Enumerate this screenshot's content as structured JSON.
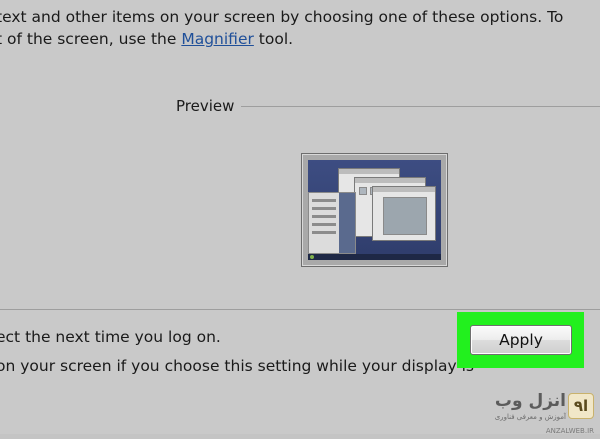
{
  "intro": {
    "line1": "text and other items on your screen by choosing one of these options. To",
    "line2_before_link": "t of the screen, use the ",
    "line2_link": "Magnifier",
    "line2_after_link": " tool."
  },
  "preview": {
    "label": "Preview"
  },
  "notes": {
    "line1": "ect the next time you log on.",
    "line2": "on your screen if you choose this setting while your display is"
  },
  "actions": {
    "apply_label": "Apply",
    "highlight_color": "#22f01e"
  },
  "watermark": {
    "logo": "ا۹",
    "name": "انزل وب",
    "subtitle": "آموزش و معرفی فناوری",
    "url": "ANZALWEB.IR"
  }
}
